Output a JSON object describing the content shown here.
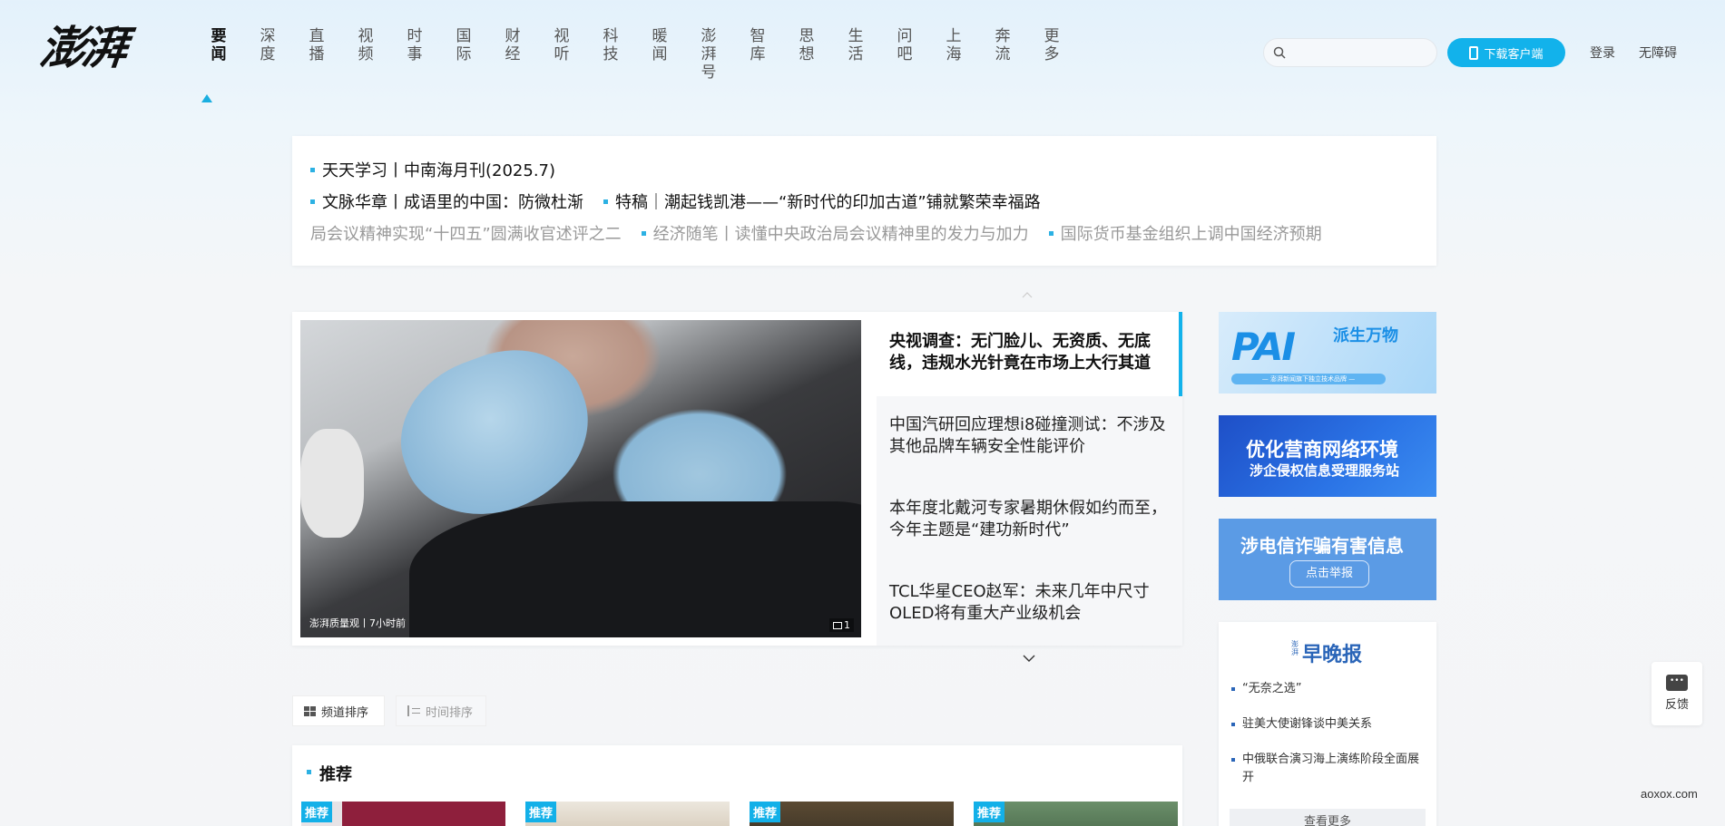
{
  "logo_text": "澎湃",
  "nav": [
    {
      "label": "要闻",
      "active": true
    },
    {
      "label": "深度"
    },
    {
      "label": "直播"
    },
    {
      "label": "视频"
    },
    {
      "label": "时事"
    },
    {
      "label": "国际"
    },
    {
      "label": "财经"
    },
    {
      "label": "视听"
    },
    {
      "label": "科技"
    },
    {
      "label": "暖闻"
    },
    {
      "label": "澎湃号"
    },
    {
      "label": "智库"
    },
    {
      "label": "思想"
    },
    {
      "label": "生活"
    },
    {
      "label": "问吧"
    },
    {
      "label": "上海"
    },
    {
      "label": "奔流"
    },
    {
      "label": "更多"
    }
  ],
  "header": {
    "search_placeholder": "",
    "download_label": "下载客户端",
    "login_label": "登录",
    "accessibility_label": "无障碍"
  },
  "ticker": {
    "line1": [
      "天天学习丨中南海月刊(2025.7)"
    ],
    "line2": [
      "文脉华章丨成语里的中国：防微杜渐",
      "特稿｜潮起钱凯港——“新时代的印加古道”铺就繁荣幸福路"
    ],
    "line3": [
      "局会议精神实现“十四五”圆满收官述评之二",
      "经济随笔丨读懂中央政治局会议精神里的发力与加力",
      "国际货币基金组织上调中国经济预期"
    ]
  },
  "headline": {
    "photo_caption": "澎湃质量观丨7小时前",
    "photo_count": "1",
    "items": [
      "央视调查：无门脸儿、无资质、无底线，违规水光针竟在市场上大行其道",
      "中国汽研回应理想i8碰撞测试：不涉及其他品牌车辆安全性能评价",
      "本年度北戴河专家暑期休假如约而至，今年主题是“建功新时代”",
      "TCL华星CEO赵军：未来几年中尺寸OLED将有重大产业级机会"
    ]
  },
  "sort": {
    "channel_label": "频道排序",
    "time_label": "时间排序"
  },
  "recommend": {
    "title": "推荐",
    "tag": "推荐"
  },
  "ads": {
    "pai_big": "PAI",
    "pai_side": "派生万物",
    "pai_bar": "— 澎湃新闻旗下独立技术品牌 —",
    "biz_title": "优化营商网络环境",
    "biz_sub": "涉企侵权信息受理服务站",
    "fraud_title": "涉电信诈骗有害信息",
    "fraud_button": "点击举报"
  },
  "evening": {
    "tag": "澎湃",
    "title": "早晚报",
    "items": [
      "“无奈之选”",
      "驻美大使谢锋谈中美关系",
      "中俄联合演习海上演练阶段全面展开"
    ],
    "more_label": "查看更多"
  },
  "feedback_label": "反馈",
  "watermark": "aoxox.com"
}
